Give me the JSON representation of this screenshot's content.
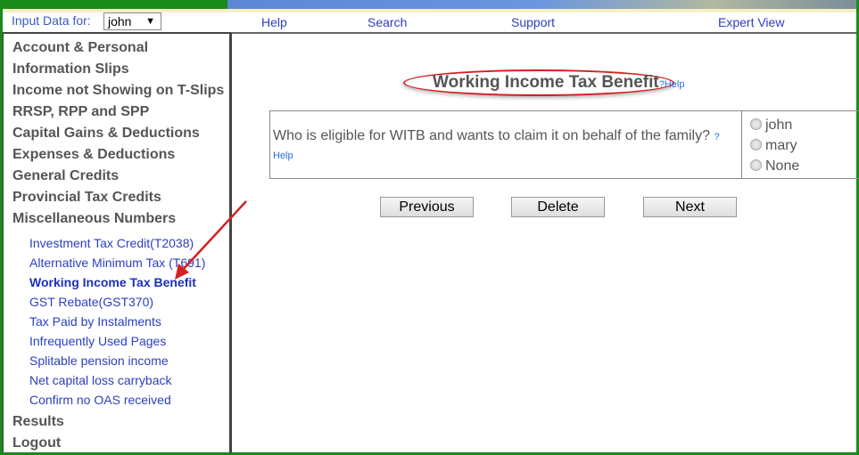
{
  "topbar": {
    "input_label": "Input Data for:",
    "selected_person": "john",
    "nav": [
      "Help",
      "Search",
      "Support",
      "Expert View"
    ]
  },
  "sidebar": {
    "sections": [
      "Account & Personal",
      "Information Slips",
      "Income not Showing on T-Slips",
      "RRSP, RPP and SPP",
      "Capital Gains & Deductions",
      "Expenses & Deductions",
      "General Credits",
      "Provincial Tax Credits",
      "Miscellaneous Numbers"
    ],
    "sub_items": [
      "Investment Tax Credit(T2038)",
      "Alternative Minimum Tax (T691)",
      "Working Income Tax Benefit",
      "GST Rebate(GST370)",
      "Tax Paid by Instalments",
      "Infrequently Used Pages",
      "Splitable pension income",
      "Net capital loss carryback",
      "Confirm no OAS received"
    ],
    "bottom": [
      "Results",
      "Logout"
    ]
  },
  "main": {
    "title": "Working Income Tax Benefit",
    "title_help": "?Help",
    "question": "Who is eligible for WITB and wants to claim it on behalf of the family?",
    "question_help": "?Help",
    "options": [
      "john",
      "mary",
      "None"
    ],
    "buttons": {
      "previous": "Previous",
      "delete": "Delete",
      "next": "Next"
    }
  },
  "colors": {
    "frame": "#1a8a1a",
    "link": "#2a3fbf",
    "annotation": "#d42020"
  }
}
